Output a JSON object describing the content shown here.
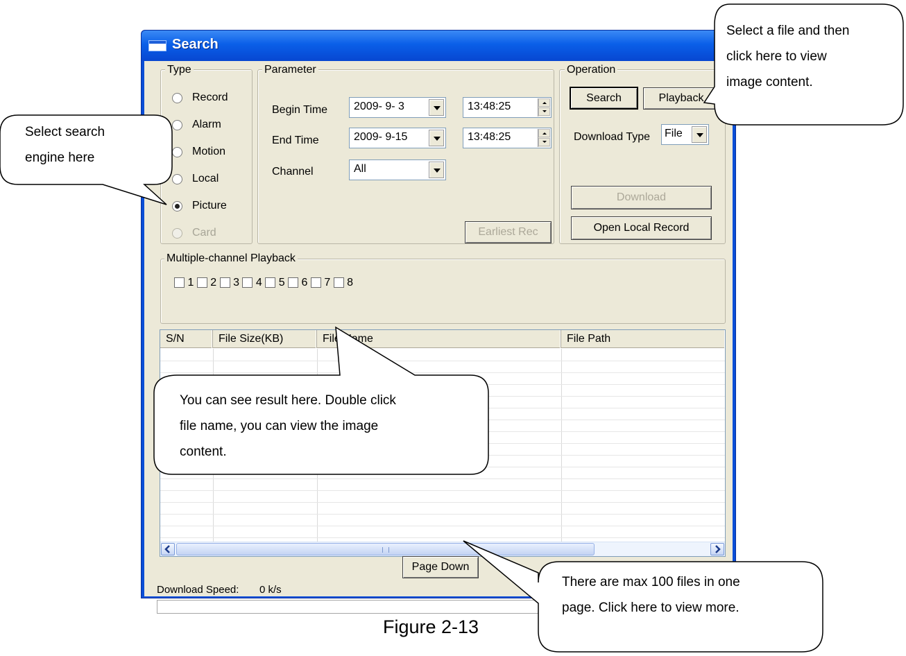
{
  "window": {
    "title": "Search"
  },
  "type_group": {
    "legend": "Type",
    "options": [
      {
        "label": "Record",
        "checked": false,
        "enabled": true
      },
      {
        "label": "Alarm",
        "checked": false,
        "enabled": true
      },
      {
        "label": "Motion",
        "checked": false,
        "enabled": true
      },
      {
        "label": "Local",
        "checked": false,
        "enabled": true
      },
      {
        "label": "Picture",
        "checked": true,
        "enabled": true
      },
      {
        "label": "Card",
        "checked": false,
        "enabled": false
      }
    ]
  },
  "parameter_group": {
    "legend": "Parameter",
    "begin_time": {
      "label": "Begin Time",
      "date": "2009- 9- 3",
      "time": "13:48:25"
    },
    "end_time": {
      "label": "End Time",
      "date": "2009- 9-15",
      "time": "13:48:25"
    },
    "channel": {
      "label": "Channel",
      "value": "All"
    },
    "earliest_rec_label": "Earliest Rec"
  },
  "operation_group": {
    "legend": "Operation",
    "search_label": "Search",
    "playback_label": "Playback",
    "download_type_label": "Download Type",
    "download_type_value": "File",
    "download_label": "Download",
    "open_local_label": "Open Local Record"
  },
  "multi_channel": {
    "legend": "Multiple-channel Playback",
    "channels": [
      "1",
      "2",
      "3",
      "4",
      "5",
      "6",
      "7",
      "8"
    ]
  },
  "table": {
    "columns": [
      "S/N",
      "File Size(KB)",
      "File Name",
      "File Path"
    ],
    "rows": []
  },
  "page_down_label": "Page Down",
  "download_speed": {
    "label": "Download Speed:",
    "value": "0 k/s"
  },
  "callouts": {
    "top_right": [
      "Select a file and then",
      "click here to view",
      "image content."
    ],
    "left": [
      "Select search",
      "engine here"
    ],
    "middle": [
      "You can see result here. Double click",
      "file name, you can view the image",
      "content."
    ],
    "bottom_right": [
      "There are max 100 files in one",
      "page. Click here to view more."
    ]
  },
  "caption": "Figure 2-13"
}
